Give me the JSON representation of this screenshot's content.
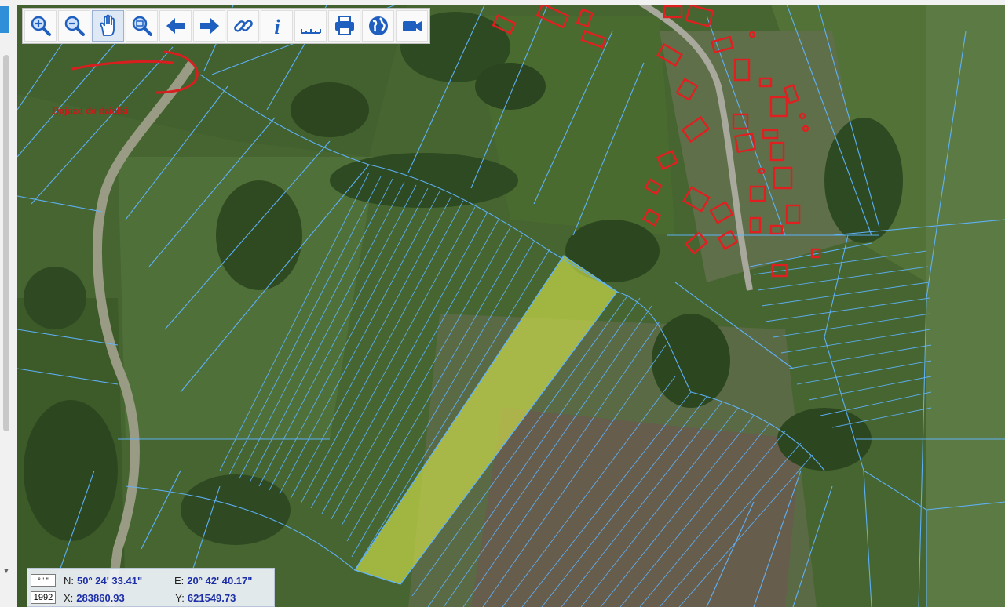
{
  "toolbar": {
    "tools": [
      {
        "name": "zoom-in-icon",
        "active": false
      },
      {
        "name": "zoom-out-icon",
        "active": false
      },
      {
        "name": "pan-hand-icon",
        "active": true
      },
      {
        "name": "zoom-area-icon",
        "active": false
      },
      {
        "name": "back-arrow-icon",
        "active": false
      },
      {
        "name": "forward-arrow-icon",
        "active": false
      },
      {
        "name": "link-icon",
        "active": false
      },
      {
        "name": "info-icon",
        "active": false
      },
      {
        "name": "measure-ruler-icon",
        "active": false
      },
      {
        "name": "print-icon",
        "active": false
      },
      {
        "name": "globe-icon",
        "active": false
      },
      {
        "name": "video-camera-icon",
        "active": false
      }
    ]
  },
  "annotation": {
    "text": "Dojazd do działki",
    "color": "#d81f1f"
  },
  "coords": {
    "format_button": "° ' \"",
    "system_button": "1992",
    "n_label": "N:",
    "n_value": "50° 24' 33.41\"",
    "e_label": "E:",
    "e_value": "20° 42' 40.17\"",
    "x_label": "X:",
    "x_value": "283860.93",
    "y_label": "Y:",
    "y_value": "621549.73"
  },
  "colors": {
    "parcel_line": "#5fb4ff",
    "building_outline": "#e02020",
    "highlight_parcel": "#d9e84a",
    "value_text": "#1d2fa8"
  }
}
